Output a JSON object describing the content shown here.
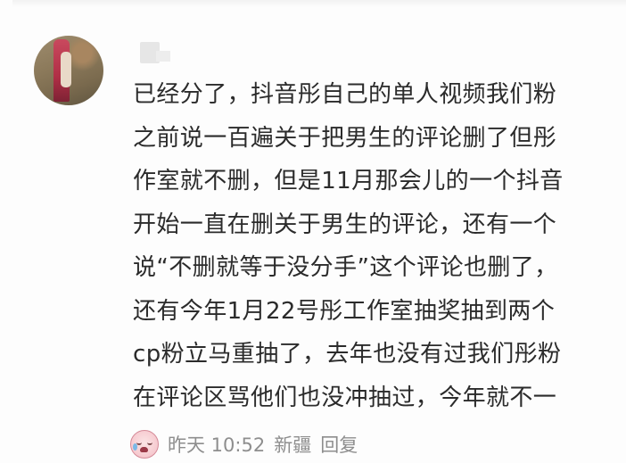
{
  "comment": {
    "lines": [
      "已经分了，抖音彤自己的单人视频我们粉",
      "之前说一百遍关于把男生的评论删了但彤",
      "作室就不删，但是11月那会儿的一个抖音",
      "开始一直在删关于男生的评论，还有一个",
      "说“不删就等于没分手”这个评论也删了，",
      "还有今年1月22号彤工作室抽奖抽到两个",
      "cp粉立马重抽了，去年也没有过我们彤粉",
      "在评论区骂他们也没冲抽过，今年就不一"
    ]
  },
  "meta": {
    "emoji_icon": "crying-laugh-emoji-icon",
    "time": "昨天 10:52",
    "location": "新疆",
    "reply": "回复"
  }
}
